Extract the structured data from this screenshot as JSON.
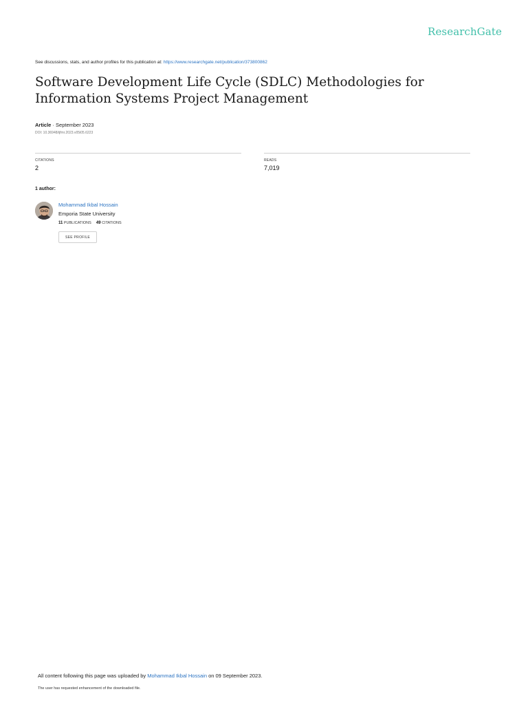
{
  "header": {
    "logo": "ResearchGate",
    "discussion_prefix": "See discussions, stats, and author profiles for this publication at: ",
    "discussion_link": "https://www.researchgate.net/publication/373800862"
  },
  "article": {
    "title": "Software Development Life Cycle (SDLC) Methodologies for Information Systems Project Management",
    "type": "Article",
    "separator": " · ",
    "date": "September 2023",
    "doi": "DOI: 10.36948/ijfmr.2023.v05i05.6223"
  },
  "stats": {
    "citations_label": "CITATIONS",
    "citations_value": "2",
    "reads_label": "READS",
    "reads_value": "7,019"
  },
  "authors": {
    "label": "1 author:",
    "items": [
      {
        "name": "Mohammad Ikbal Hossain",
        "institution": "Emporia State University",
        "publications_count": "11",
        "publications_label": "PUBLICATIONS",
        "citations_count": "49",
        "citations_label": "CITATIONS",
        "button_label": "SEE PROFILE"
      }
    ]
  },
  "footer": {
    "uploaded_prefix": "All content following this page was uploaded by ",
    "uploaded_by": "Mohammad Ikbal Hossain",
    "uploaded_suffix": " on 09 September 2023.",
    "note": "The user has requested enhancement of the downloaded file."
  },
  "colors": {
    "brand": "#40bfa9",
    "link": "#2b73c2"
  }
}
